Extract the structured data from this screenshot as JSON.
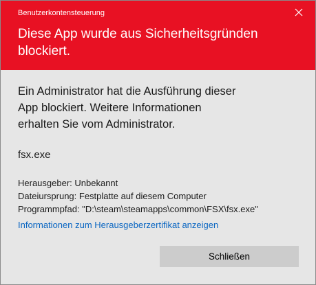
{
  "window": {
    "title": "Benutzerkontensteuerung",
    "close_icon": "close-icon"
  },
  "header": {
    "heading": "Diese App wurde aus Sicherheitsgründen blockiert.",
    "background_color": "#e81123"
  },
  "body": {
    "description": "Ein Administrator hat die Ausführung dieser App blockiert. Weitere Informationen erhalten Sie vom Administrator.",
    "app_name": "fsx.exe",
    "details": {
      "publisher": "Herausgeber: Unbekannt",
      "origin": "Dateiursprung: Festplatte auf diesem Computer",
      "path": "Programmpfad: \"D:\\steam\\steamapps\\common\\FSX\\fsx.exe\""
    },
    "cert_link": "Informationen zum Herausgeberzertifikat anzeigen",
    "link_color": "#0a66c2"
  },
  "actions": {
    "close_label": "Schließen"
  }
}
